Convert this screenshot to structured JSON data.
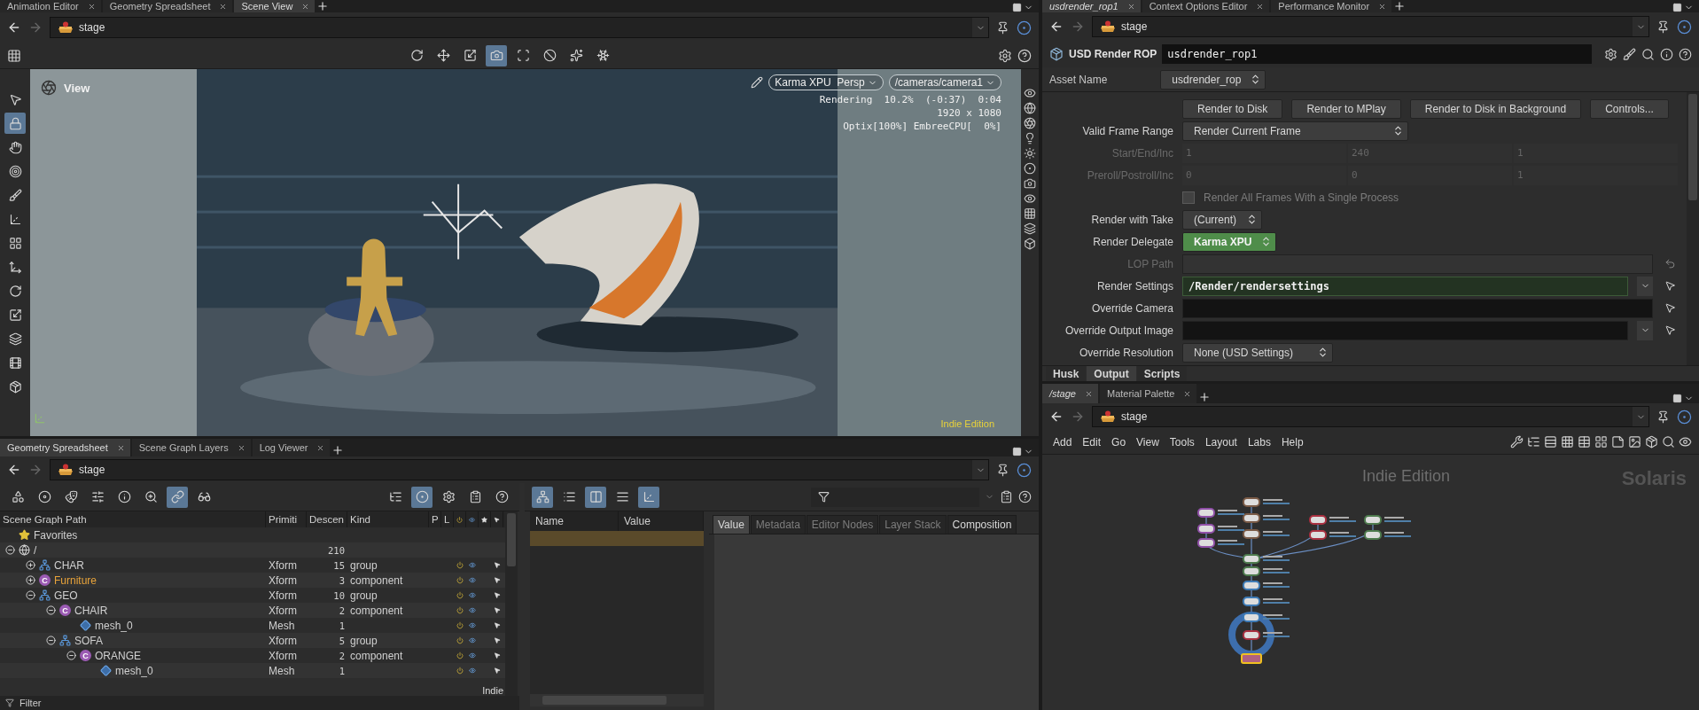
{
  "scene_view": {
    "tabs": [
      {
        "label": "Animation Editor",
        "selected": false
      },
      {
        "label": "Geometry Spreadsheet",
        "selected": false
      },
      {
        "label": "Scene View",
        "selected": true
      }
    ],
    "path": "stage",
    "toolbar_buttons": [
      {
        "selected": false
      },
      {
        "selected": false
      },
      {
        "selected": false
      },
      {
        "selected": true
      },
      {
        "selected": false
      },
      {
        "selected": false
      },
      {
        "selected": false
      },
      {
        "selected": false
      }
    ],
    "tools": [
      {
        "selected": false
      },
      {
        "selected": true
      },
      {
        "selected": false
      },
      {
        "selected": false
      },
      {
        "selected": false
      },
      {
        "selected": false
      },
      {
        "selected": false
      },
      {
        "selected": false
      },
      {
        "selected": false
      },
      {
        "selected": false
      },
      {
        "selected": false
      },
      {
        "selected": false
      },
      {
        "selected": false
      }
    ],
    "viewport": {
      "title": "View",
      "renderer": "Karma XPU  Persp",
      "camera": "/cameras/camera1",
      "status": [
        "Rendering  10.2%  (-0:37)  0:04",
        "1920 x 1080",
        "Optix[100%] EmbreeCPU[  0%]"
      ],
      "edition": "Indie Edition"
    }
  },
  "spreadsheet": {
    "tabs": [
      {
        "label": "Geometry Spreadsheet",
        "selected": true
      },
      {
        "label": "Scene Graph Layers",
        "selected": false
      },
      {
        "label": "Log Viewer",
        "selected": false
      }
    ],
    "path": "stage",
    "toolbar_buttons": [
      {
        "selected": false
      },
      {
        "selected": false
      },
      {
        "selected": false
      },
      {
        "selected": false
      },
      {
        "selected": false
      },
      {
        "selected": false
      },
      {
        "selected": true
      },
      {
        "selected": false
      },
      {
        "selected": false
      },
      {
        "selected": true
      },
      {
        "selected": false
      },
      {
        "selected": false
      },
      {
        "selected": false
      }
    ],
    "columns": [
      "Scene Graph Path",
      "Primiti",
      "Descen",
      "Kind",
      "P",
      "L"
    ],
    "rows": [
      {
        "kind": "favorites",
        "name": "Favorites",
        "highlighted": false
      },
      {
        "kind": "root",
        "name": "/",
        "descendants": "210",
        "expanded": true,
        "highlighted": false,
        "children": [
          {
            "kind": "group",
            "name": "CHAR",
            "prim_type": "Xform",
            "descendants": "15",
            "kind_label": "group",
            "expanded": false,
            "highlighted": false
          },
          {
            "kind": "component",
            "badge": "C",
            "name": "Furniture",
            "prim_type": "Xform",
            "descendants": "3",
            "kind_label": "component",
            "expanded": false,
            "highlighted": true
          },
          {
            "kind": "group",
            "name": "GEO",
            "prim_type": "Xform",
            "descendants": "10",
            "kind_label": "group",
            "expanded": true,
            "highlighted": false,
            "children": [
              {
                "kind": "component",
                "badge": "C",
                "name": "CHAIR",
                "prim_type": "Xform",
                "descendants": "2",
                "kind_label": "component",
                "expanded": true,
                "highlighted": false,
                "children": [
                  {
                    "kind": "mesh",
                    "name": "mesh_0",
                    "prim_type": "Mesh",
                    "descendants": "1",
                    "highlighted": false
                  }
                ]
              },
              {
                "kind": "group",
                "name": "SOFA",
                "prim_type": "Xform",
                "descendants": "5",
                "kind_label": "group",
                "expanded": true,
                "highlighted": false,
                "children": [
                  {
                    "kind": "component",
                    "badge": "C",
                    "name": "ORANGE",
                    "prim_type": "Xform",
                    "descendants": "2",
                    "kind_label": "component",
                    "expanded": true,
                    "highlighted": false,
                    "children": [
                      {
                        "kind": "mesh",
                        "name": "mesh_0",
                        "prim_type": "Mesh",
                        "descendants": "1",
                        "highlighted": false
                      }
                    ]
                  }
                ]
              }
            ]
          }
        ]
      }
    ],
    "badge": "Indie",
    "filter_label": "Filter"
  },
  "inspector": {
    "toolbar_buttons": [
      {
        "selected": true
      },
      {
        "selected": false
      },
      {
        "selected": true
      },
      {
        "selected": false
      },
      {
        "selected": true
      }
    ],
    "columns": [
      "Name",
      "Value"
    ],
    "rows": [
      {
        "selected": true
      }
    ],
    "tabs": [
      {
        "label": "Value",
        "selected": true,
        "disabled": false
      },
      {
        "label": "Metadata",
        "selected": false,
        "disabled": true
      },
      {
        "label": "Editor Nodes",
        "selected": false,
        "disabled": true
      },
      {
        "label": "Layer Stack",
        "selected": false,
        "disabled": true
      },
      {
        "label": "Composition",
        "selected": false,
        "disabled": false
      }
    ]
  },
  "parameters": {
    "tabs": [
      {
        "label": "usdrender_rop1",
        "selected": true
      },
      {
        "label": "Context Options Editor",
        "selected": false
      },
      {
        "label": "Performance Monitor",
        "selected": false
      }
    ],
    "path": "stage",
    "node_type": "USD Render ROP",
    "node_name": "usdrender_rop1",
    "asset_name": {
      "label": "Asset Name",
      "value": "usdrender_rop"
    },
    "buttons": [
      "Render to Disk",
      "Render to MPlay",
      "Render to Disk in Background",
      "Controls..."
    ],
    "params": [
      {
        "kind": "menu",
        "label": "Valid Frame Range",
        "value": "Render Current Frame",
        "disabled": false,
        "highlighted": false
      },
      {
        "kind": "triple",
        "label": "Start/End/Inc",
        "values": [
          "1",
          "240",
          "1"
        ],
        "disabled": true
      },
      {
        "kind": "triple",
        "label": "Preroll/Postroll/Inc",
        "values": [
          "0",
          "0",
          "1"
        ],
        "disabled": true
      },
      {
        "kind": "checkbox",
        "label": "Render All Frames With a Single Process",
        "checked": false,
        "disabled": true
      },
      {
        "kind": "menu",
        "label": "Render with Take",
        "value": "(Current)",
        "disabled": false,
        "highlighted": false
      },
      {
        "kind": "menu",
        "label": "Render Delegate",
        "value": "Karma XPU",
        "disabled": false,
        "highlighted": true
      },
      {
        "kind": "string",
        "label": "LOP Path",
        "dropdown": false,
        "disabled": true,
        "highlighted": false
      },
      {
        "kind": "string",
        "label": "Render Settings",
        "value": "/Render/rendersettings",
        "dropdown": true,
        "disabled": false,
        "highlighted": true
      },
      {
        "kind": "string",
        "label": "Override Camera",
        "dropdown": false,
        "disabled": false,
        "highlighted": false
      },
      {
        "kind": "string",
        "label": "Override Output Image",
        "dropdown": true,
        "disabled": false,
        "highlighted": false
      },
      {
        "kind": "menu",
        "label": "Override Resolution",
        "value": "None (USD Settings)",
        "disabled": false,
        "highlighted": false
      }
    ],
    "folders": [
      {
        "label": "Husk",
        "selected": false
      },
      {
        "label": "Output",
        "selected": true
      },
      {
        "label": "Scripts",
        "selected": false
      }
    ]
  },
  "network": {
    "tabs": [
      {
        "label": "/stage",
        "selected": true
      },
      {
        "label": "Material Palette",
        "selected": false
      }
    ],
    "path": "stage",
    "menu": [
      "Add",
      "Edit",
      "Go",
      "View",
      "Tools",
      "Layout",
      "Labs",
      "Help"
    ],
    "edition": "Indie Edition",
    "context": "Solaris"
  }
}
